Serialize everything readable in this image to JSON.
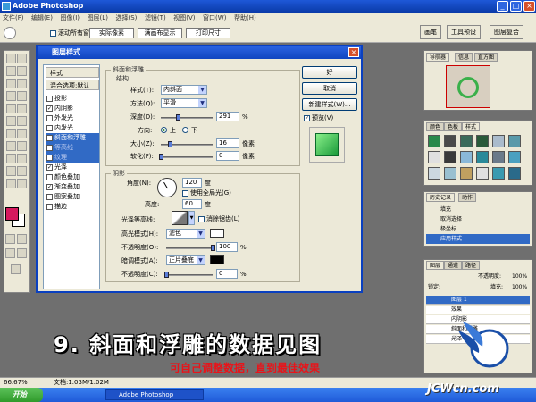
{
  "window": {
    "title": "Adobe Photoshop",
    "min": "_",
    "max": "□",
    "close": "×"
  },
  "menu": [
    "文件(F)",
    "编辑(E)",
    "图像(I)",
    "图层(L)",
    "选择(S)",
    "滤镜(T)",
    "视图(V)",
    "窗口(W)",
    "帮助(H)"
  ],
  "options": {
    "scroll_all": "滚动所有窗口",
    "actual_pixels": "实际像素",
    "fit_screen": "满画布显示",
    "print_size": "打印尺寸"
  },
  "wells": [
    "画笔",
    "工具预设",
    "图层复合"
  ],
  "dialog": {
    "title": "图层样式",
    "close": "×",
    "style_list": {
      "styles": "样式",
      "blending": "混合选项:默认",
      "items": [
        {
          "label": "投影",
          "checked": false
        },
        {
          "label": "内阴影",
          "checked": true
        },
        {
          "label": "外发光",
          "checked": false
        },
        {
          "label": "内发光",
          "checked": false
        },
        {
          "label": "斜面和浮雕",
          "checked": true
        },
        {
          "label": "等高线",
          "checked": false
        },
        {
          "label": "纹理",
          "checked": false
        },
        {
          "label": "光泽",
          "checked": true
        },
        {
          "label": "颜色叠加",
          "checked": false
        },
        {
          "label": "渐变叠加",
          "checked": true
        },
        {
          "label": "图案叠加",
          "checked": false
        },
        {
          "label": "描边",
          "checked": false
        }
      ]
    },
    "bevel": {
      "section": "斜面和浮雕",
      "structure": "结构",
      "style_label": "样式(T):",
      "style_value": "内斜面",
      "technique_label": "方法(Q):",
      "technique_value": "平滑",
      "depth_label": "深度(D):",
      "depth_value": "291",
      "depth_unit": "%",
      "depth_level": 0.29,
      "direction_label": "方向:",
      "dir_up": "上",
      "dir_down": "下",
      "size_label": "大小(Z):",
      "size_value": "16",
      "size_unit": "像素",
      "soften_label": "软化(F):",
      "soften_value": "0",
      "soften_unit": "像素"
    },
    "shading": {
      "section": "阴影",
      "angle_label": "角度(N):",
      "angle_value": "120",
      "angle_unit": "度",
      "global_light": "使用全局光(G)",
      "altitude_label": "高度:",
      "altitude_value": "60",
      "altitude_unit": "度",
      "gloss_label": "光泽等高线:",
      "antialias": "消除锯齿(L)",
      "highlight_label": "高光模式(H):",
      "highlight_value": "滤色",
      "highlight_opacity_label": "不透明度(O):",
      "highlight_opacity": "100",
      "shadow_label": "暗调模式(A):",
      "shadow_value": "正片叠底",
      "shadow_opacity_label": "不透明度(C):",
      "shadow_opacity": "0",
      "percent": "%"
    },
    "buttons": {
      "ok": "好",
      "cancel": "取消",
      "new_style": "新建样式(W)...",
      "preview": "预览(V)"
    }
  },
  "navigator": {
    "tabs": [
      "导航器",
      "信息",
      "直方图"
    ]
  },
  "swatches": {
    "tabs": [
      "颜色",
      "色板",
      "样式"
    ]
  },
  "history": {
    "tabs": [
      "历史记录",
      "动作"
    ],
    "items": [
      "填充",
      "取消选择",
      "极坐标",
      "应用样式"
    ]
  },
  "layers": {
    "tabs": [
      "图层",
      "通道",
      "路径"
    ],
    "opacity_label": "不透明度:",
    "opacity_value": "100%",
    "lock_label": "锁定:",
    "fill_label": "填充:",
    "fill_value": "100%",
    "rows": [
      "图层 1",
      "效果",
      "内阴影",
      "斜面和浮雕",
      "光泽"
    ]
  },
  "status": {
    "zoom": "66.67%",
    "doc": "文档:1.03M/1.02M"
  },
  "taskbar": {
    "start": "开始",
    "item": "Adobe Photoshop"
  },
  "caption": {
    "title": "9. 斜面和浮雕的数据见图",
    "subtitle": "可自己调整数据，直到最佳效果"
  },
  "watermark": "JCWcn.com",
  "colors": {
    "foreground": "#d6195e",
    "background": "#ffffff",
    "accent": "#316ac5"
  }
}
